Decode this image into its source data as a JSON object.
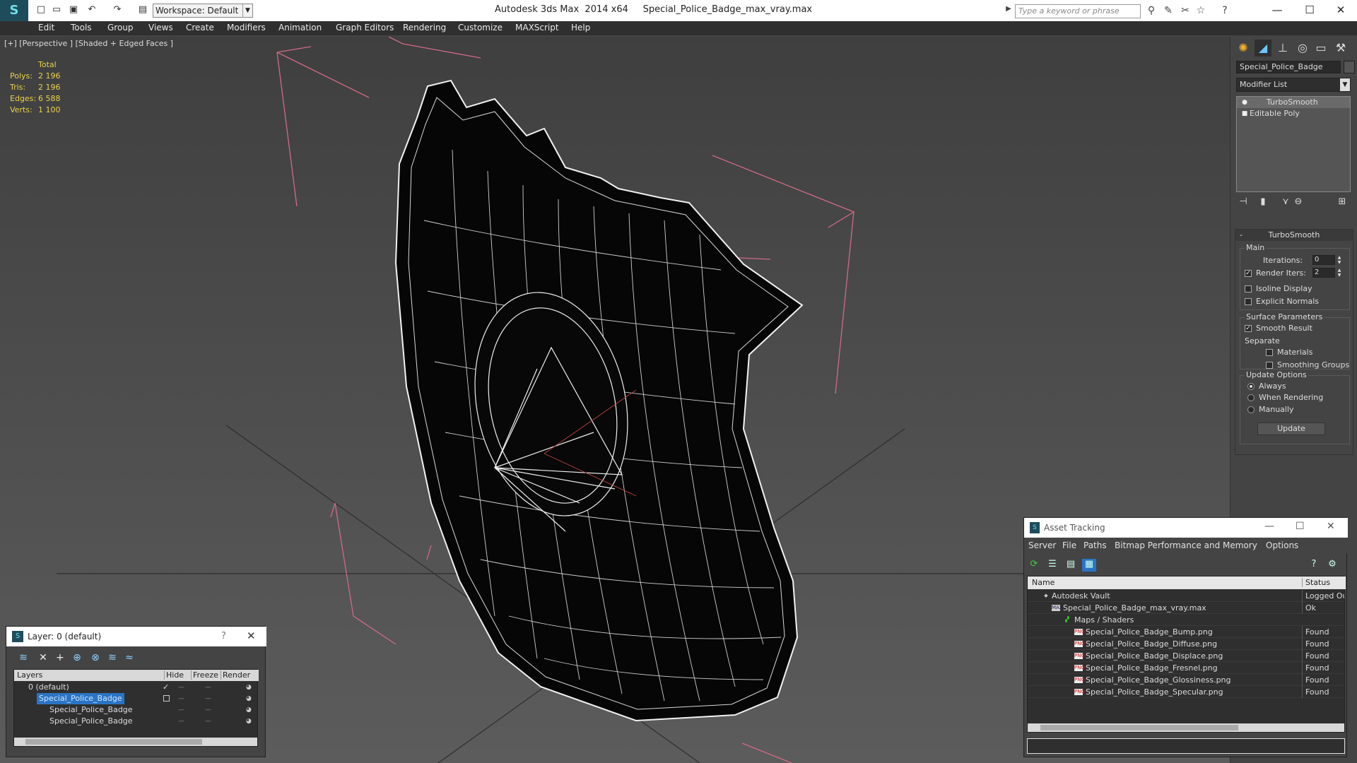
{
  "titlebar": {
    "app_title": "Autodesk 3ds Max  2014 x64",
    "file_title": "Special_Police_Badge_max_vray.max",
    "workspace": "Workspace: Default",
    "search_placeholder": "Type a keyword or phrase"
  },
  "menu": [
    "Edit",
    "Tools",
    "Group",
    "Views",
    "Create",
    "Modifiers",
    "Animation",
    "Graph Editors",
    "Rendering",
    "Customize",
    "MAXScript",
    "Help"
  ],
  "viewport": {
    "label": "[+] [Perspective ] [Shaded + Edged Faces ]",
    "stats": {
      "total": "Total",
      "polys_label": "Polys:",
      "polys": "2 196",
      "tris_label": "Tris:",
      "tris": "2 196",
      "edges_label": "Edges:",
      "edges": "6 588",
      "verts_label": "Verts:",
      "verts": "1 100"
    }
  },
  "command_panel": {
    "object_name": "Special_Police_Badge",
    "modifier_list": "Modifier List",
    "stack": [
      "TurboSmooth",
      "Editable Poly"
    ],
    "rollout": {
      "title": "TurboSmooth",
      "main": "Main",
      "iterations_label": "Iterations:",
      "iterations": "0",
      "render_iters_label": "Render Iters:",
      "render_iters": "2",
      "isoline": "Isoline Display",
      "explicit_normals": "Explicit Normals",
      "surface_params": "Surface Parameters",
      "smooth_result": "Smooth Result",
      "separate": "Separate",
      "materials": "Materials",
      "smoothing_groups": "Smoothing Groups",
      "update_options": "Update Options",
      "always": "Always",
      "when_rendering": "When Rendering",
      "manually": "Manually",
      "update_button": "Update"
    }
  },
  "layer_window": {
    "title": "Layer: 0 (default)",
    "help": "?",
    "headers": {
      "layers": "Layers",
      "hide": "Hide",
      "freeze": "Freeze",
      "render": "Render"
    },
    "rows": [
      "0 (default)",
      "Special_Police_Badge",
      "Special_Police_Badge",
      "Special_Police_Badge"
    ]
  },
  "asset_tracking": {
    "title": "Asset Tracking",
    "menu": [
      "Server",
      "File",
      "Paths",
      "Bitmap Performance and Memory",
      "Options"
    ],
    "headers": {
      "name": "Name",
      "status": "Status"
    },
    "rows": [
      {
        "name": "Autodesk Vault",
        "status": "Logged Out"
      },
      {
        "name": "Special_Police_Badge_max_vray.max",
        "status": "Ok"
      },
      {
        "name": "Maps / Shaders",
        "status": ""
      },
      {
        "name": "Special_Police_Badge_Bump.png",
        "status": "Found"
      },
      {
        "name": "Special_Police_Badge_Diffuse.png",
        "status": "Found"
      },
      {
        "name": "Special_Police_Badge_Displace.png",
        "status": "Found"
      },
      {
        "name": "Special_Police_Badge_Fresnel.png",
        "status": "Found"
      },
      {
        "name": "Special_Police_Badge_Glossiness.png",
        "status": "Found"
      },
      {
        "name": "Special_Police_Badge_Specular.png",
        "status": "Found"
      }
    ]
  }
}
